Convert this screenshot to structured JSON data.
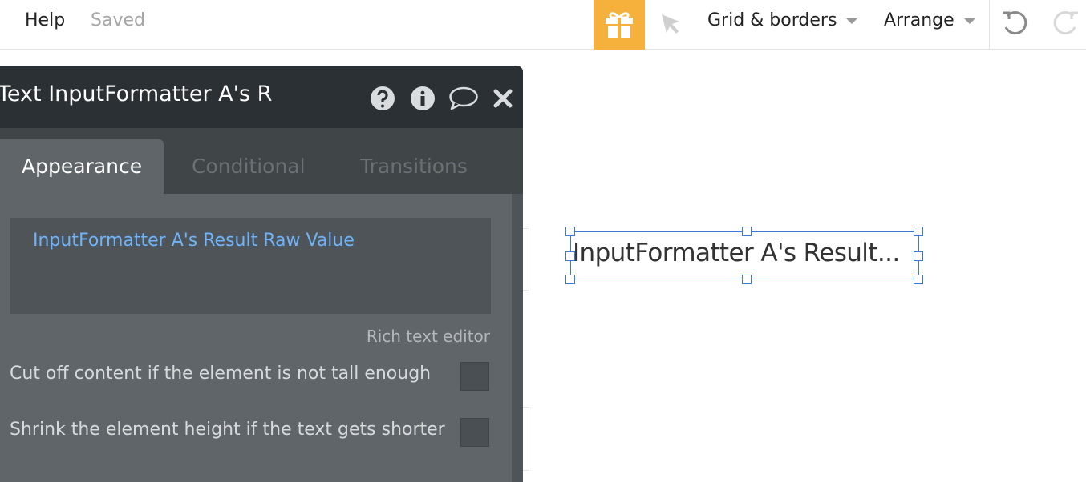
{
  "topbar": {
    "help_label": "Help",
    "status_label": "Saved",
    "grid_borders_label": "Grid & borders",
    "arrange_label": "Arrange",
    "gift_color": "#f5b13b"
  },
  "panel": {
    "title": "Text InputFormatter A's R",
    "tabs": [
      {
        "label": "Appearance",
        "active": true
      },
      {
        "label": "Conditional",
        "active": false
      },
      {
        "label": "Transitions",
        "active": false
      }
    ],
    "expression": "InputFormatter A's Result Raw Value",
    "rich_text_link": "Rich text editor",
    "options": [
      {
        "label": "Cut off content if the element is not tall enough",
        "checked": false
      },
      {
        "label": "Shrink the element height if the text gets shorter",
        "checked": false
      }
    ]
  },
  "canvas": {
    "selected_element_text": "InputFormatter A's Result...",
    "selection_color": "#3a7bd5"
  }
}
